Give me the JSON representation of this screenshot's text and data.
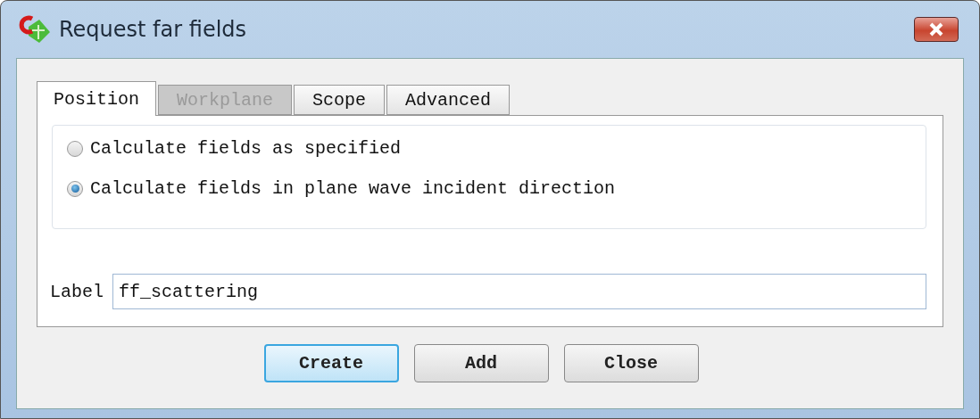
{
  "window": {
    "title": "Request far fields"
  },
  "tabs": [
    {
      "label": "Position",
      "selected": true,
      "disabled": false
    },
    {
      "label": "Workplane",
      "selected": false,
      "disabled": true
    },
    {
      "label": "Scope",
      "selected": false,
      "disabled": false
    },
    {
      "label": "Advanced",
      "selected": false,
      "disabled": false
    }
  ],
  "options": [
    {
      "label": "Calculate fields as specified",
      "selected": false
    },
    {
      "label": "Calculate fields in plane wave incident direction",
      "selected": true
    }
  ],
  "label_field": {
    "label": "Label",
    "value": "ff_scattering"
  },
  "buttons": [
    {
      "label": "Create",
      "default": true
    },
    {
      "label": "Add",
      "default": false
    },
    {
      "label": "Close",
      "default": false
    }
  ]
}
